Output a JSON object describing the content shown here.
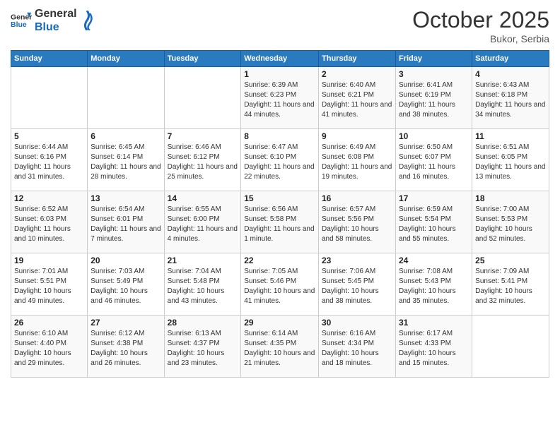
{
  "logo": {
    "general": "General",
    "blue": "Blue"
  },
  "header": {
    "month": "October 2025",
    "location": "Bukor, Serbia"
  },
  "weekdays": [
    "Sunday",
    "Monday",
    "Tuesday",
    "Wednesday",
    "Thursday",
    "Friday",
    "Saturday"
  ],
  "weeks": [
    [
      {
        "day": "",
        "info": ""
      },
      {
        "day": "",
        "info": ""
      },
      {
        "day": "",
        "info": ""
      },
      {
        "day": "1",
        "info": "Sunrise: 6:39 AM\nSunset: 6:23 PM\nDaylight: 11 hours and 44 minutes."
      },
      {
        "day": "2",
        "info": "Sunrise: 6:40 AM\nSunset: 6:21 PM\nDaylight: 11 hours and 41 minutes."
      },
      {
        "day": "3",
        "info": "Sunrise: 6:41 AM\nSunset: 6:19 PM\nDaylight: 11 hours and 38 minutes."
      },
      {
        "day": "4",
        "info": "Sunrise: 6:43 AM\nSunset: 6:18 PM\nDaylight: 11 hours and 34 minutes."
      }
    ],
    [
      {
        "day": "5",
        "info": "Sunrise: 6:44 AM\nSunset: 6:16 PM\nDaylight: 11 hours and 31 minutes."
      },
      {
        "day": "6",
        "info": "Sunrise: 6:45 AM\nSunset: 6:14 PM\nDaylight: 11 hours and 28 minutes."
      },
      {
        "day": "7",
        "info": "Sunrise: 6:46 AM\nSunset: 6:12 PM\nDaylight: 11 hours and 25 minutes."
      },
      {
        "day": "8",
        "info": "Sunrise: 6:47 AM\nSunset: 6:10 PM\nDaylight: 11 hours and 22 minutes."
      },
      {
        "day": "9",
        "info": "Sunrise: 6:49 AM\nSunset: 6:08 PM\nDaylight: 11 hours and 19 minutes."
      },
      {
        "day": "10",
        "info": "Sunrise: 6:50 AM\nSunset: 6:07 PM\nDaylight: 11 hours and 16 minutes."
      },
      {
        "day": "11",
        "info": "Sunrise: 6:51 AM\nSunset: 6:05 PM\nDaylight: 11 hours and 13 minutes."
      }
    ],
    [
      {
        "day": "12",
        "info": "Sunrise: 6:52 AM\nSunset: 6:03 PM\nDaylight: 11 hours and 10 minutes."
      },
      {
        "day": "13",
        "info": "Sunrise: 6:54 AM\nSunset: 6:01 PM\nDaylight: 11 hours and 7 minutes."
      },
      {
        "day": "14",
        "info": "Sunrise: 6:55 AM\nSunset: 6:00 PM\nDaylight: 11 hours and 4 minutes."
      },
      {
        "day": "15",
        "info": "Sunrise: 6:56 AM\nSunset: 5:58 PM\nDaylight: 11 hours and 1 minute."
      },
      {
        "day": "16",
        "info": "Sunrise: 6:57 AM\nSunset: 5:56 PM\nDaylight: 10 hours and 58 minutes."
      },
      {
        "day": "17",
        "info": "Sunrise: 6:59 AM\nSunset: 5:54 PM\nDaylight: 10 hours and 55 minutes."
      },
      {
        "day": "18",
        "info": "Sunrise: 7:00 AM\nSunset: 5:53 PM\nDaylight: 10 hours and 52 minutes."
      }
    ],
    [
      {
        "day": "19",
        "info": "Sunrise: 7:01 AM\nSunset: 5:51 PM\nDaylight: 10 hours and 49 minutes."
      },
      {
        "day": "20",
        "info": "Sunrise: 7:03 AM\nSunset: 5:49 PM\nDaylight: 10 hours and 46 minutes."
      },
      {
        "day": "21",
        "info": "Sunrise: 7:04 AM\nSunset: 5:48 PM\nDaylight: 10 hours and 43 minutes."
      },
      {
        "day": "22",
        "info": "Sunrise: 7:05 AM\nSunset: 5:46 PM\nDaylight: 10 hours and 41 minutes."
      },
      {
        "day": "23",
        "info": "Sunrise: 7:06 AM\nSunset: 5:45 PM\nDaylight: 10 hours and 38 minutes."
      },
      {
        "day": "24",
        "info": "Sunrise: 7:08 AM\nSunset: 5:43 PM\nDaylight: 10 hours and 35 minutes."
      },
      {
        "day": "25",
        "info": "Sunrise: 7:09 AM\nSunset: 5:41 PM\nDaylight: 10 hours and 32 minutes."
      }
    ],
    [
      {
        "day": "26",
        "info": "Sunrise: 6:10 AM\nSunset: 4:40 PM\nDaylight: 10 hours and 29 minutes."
      },
      {
        "day": "27",
        "info": "Sunrise: 6:12 AM\nSunset: 4:38 PM\nDaylight: 10 hours and 26 minutes."
      },
      {
        "day": "28",
        "info": "Sunrise: 6:13 AM\nSunset: 4:37 PM\nDaylight: 10 hours and 23 minutes."
      },
      {
        "day": "29",
        "info": "Sunrise: 6:14 AM\nSunset: 4:35 PM\nDaylight: 10 hours and 21 minutes."
      },
      {
        "day": "30",
        "info": "Sunrise: 6:16 AM\nSunset: 4:34 PM\nDaylight: 10 hours and 18 minutes."
      },
      {
        "day": "31",
        "info": "Sunrise: 6:17 AM\nSunset: 4:33 PM\nDaylight: 10 hours and 15 minutes."
      },
      {
        "day": "",
        "info": ""
      }
    ]
  ]
}
